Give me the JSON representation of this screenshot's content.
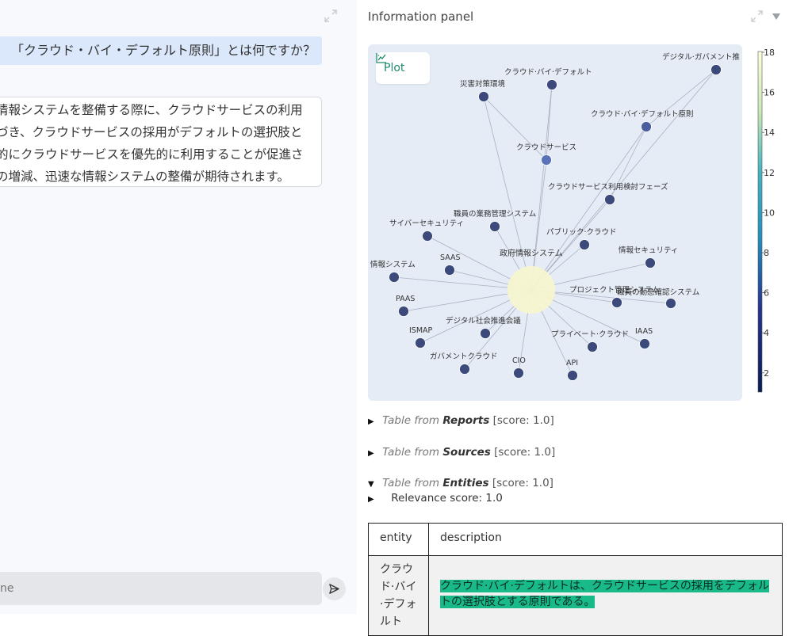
{
  "chat": {
    "user_message": "「クラウド・バイ・デフォルト原則」とは何ですか？",
    "bot_lines": [
      "情報システムを整備する際に、クラウドサービスの利用",
      "づき、クラウドサービスの採用がデフォルトの選択肢と",
      "的にクラウドサービスを優先的に利用することが促進さ",
      "の増減、迅速な情報システムの整備が期待されます。"
    ],
    "input_placeholder": "ne"
  },
  "panel": {
    "title": "Information panel",
    "plot_button_label": "Plot"
  },
  "sections": [
    {
      "prefix": "Table from",
      "name": "Reports",
      "score": "[score: 1.0]",
      "expanded": false
    },
    {
      "prefix": "Table from",
      "name": "Sources",
      "score": "[score: 1.0]",
      "expanded": false
    },
    {
      "prefix": "Table from",
      "name": "Entities",
      "score": "[score: 1.0]",
      "expanded": true
    }
  ],
  "relevance": {
    "label": "Relevance score",
    "value": ": 1.0"
  },
  "table": {
    "headers": [
      "entity",
      "description"
    ],
    "row_entity_lines": [
      "クラウ",
      "ド·バイ",
      "·デフォ",
      "ルト"
    ],
    "row_description_lines": [
      "クラウド·バイ·デフォルトは、クラウドサービスの採用をデフォル",
      "トの選択肢とする原則である。"
    ]
  },
  "graph": {
    "center_label": "政府情報システム",
    "nodes": [
      {
        "label": "デジタル·ガバメント推",
        "value": 3
      },
      {
        "label": "クラウド·バイ·デフォルト",
        "value": 3
      },
      {
        "label": "災害対策環境",
        "value": 3
      },
      {
        "label": "クラウド·バイ·デフォルト原則",
        "value": 4
      },
      {
        "label": "クラウドサービス",
        "value": 5
      },
      {
        "label": "クラウドサービス利用検討フェーズ",
        "value": 3
      },
      {
        "label": "職員の業務管理システム",
        "value": 3
      },
      {
        "label": "サイバーセキュリティ",
        "value": 3
      },
      {
        "label": "パブリック·クラウド",
        "value": 3
      },
      {
        "label": "SAAS",
        "value": 3
      },
      {
        "label": "情報セキュリティ",
        "value": 3
      },
      {
        "label": "情報システム",
        "value": 3
      },
      {
        "label": "プロジェクト管理システム",
        "value": 3
      },
      {
        "label": "職員の勤怠確認システム",
        "value": 3
      },
      {
        "label": "PAAS",
        "value": 3
      },
      {
        "label": "デジタル社会推進会議",
        "value": 3
      },
      {
        "label": "ISMAP",
        "value": 3
      },
      {
        "label": "プライベート·クラウド",
        "value": 3
      },
      {
        "label": "IAAS",
        "value": 3
      },
      {
        "label": "ガバメントクラウド",
        "value": 3
      },
      {
        "label": "CIO",
        "value": 3
      },
      {
        "label": "API",
        "value": 3
      }
    ],
    "center_value": 18
  },
  "colorbar": {
    "ticks": [
      "18",
      "16",
      "14",
      "12",
      "10",
      "8",
      "6",
      "4",
      "2"
    ]
  },
  "colors": {
    "highlight": "#19b98a",
    "plot_bg": "#e5ecf6",
    "node": "#3b4a7a",
    "center": "#f7f6d0"
  }
}
